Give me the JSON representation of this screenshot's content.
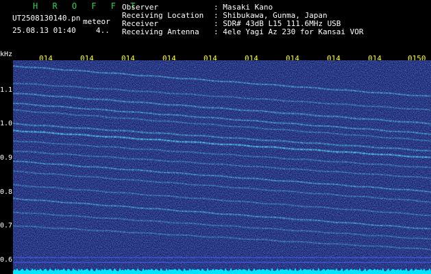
{
  "header": {
    "title": "H R O F F T",
    "filename": "UT2508130140.pn",
    "meteor_label": "meteor",
    "datetime": "25.08.13 01:40",
    "count": "4..",
    "observer_label": "Observer",
    "observer_value": ": Masaki Kano",
    "location_label": "Receiving Location",
    "location_value": ": Shibukawa, Gunma, Japan",
    "receiver_label": "Receiver",
    "receiver_value": ": SDR# 43dB L15 111.6MHz USB",
    "antenna_label": "Receiving Antenna",
    "antenna_value": ": 4ele Yagi Az 230 for Kansai VOR"
  },
  "axes": {
    "y_unit": "kHz",
    "y_ticks": [
      "1.1",
      "1.0",
      "0.9",
      "0.8",
      "0.7",
      "0.6"
    ],
    "x_ticks": [
      "014",
      "014",
      "014",
      "014",
      "014",
      "014",
      "014",
      "014",
      "014",
      "0150"
    ]
  },
  "colors": {
    "background": "#000000",
    "title_green": "#2bd34a",
    "text_white": "#ffffff",
    "tick_yellow": "#ffff00",
    "noise_blue": "#1d2c9e",
    "signal_cyan": "#5fe6ff",
    "baseline_cyan": "#00e5ff"
  },
  "chart_data": {
    "type": "heatmap",
    "title": "",
    "xlabel": "",
    "ylabel": "kHz",
    "ylim": [
      0.58,
      1.19
    ],
    "y_ticks": [
      1.1,
      1.0,
      0.9,
      0.8,
      0.7,
      0.6
    ],
    "x_tick_labels": [
      "014",
      "014",
      "014",
      "014",
      "014",
      "014",
      "014",
      "014",
      "014",
      "0150"
    ],
    "signal_traces_khz": [
      {
        "start": 1.17,
        "end": 1.08
      },
      {
        "start": 1.12,
        "end": 1.04
      },
      {
        "start": 1.09,
        "end": 1.0
      },
      {
        "start": 1.06,
        "end": 0.97
      },
      {
        "start": 1.04,
        "end": 0.95
      },
      {
        "start": 1.0,
        "end": 0.92
      },
      {
        "start": 0.98,
        "end": 0.9
      },
      {
        "start": 0.95,
        "end": 0.87
      },
      {
        "start": 0.92,
        "end": 0.84
      },
      {
        "start": 0.89,
        "end": 0.8
      },
      {
        "start": 0.86,
        "end": 0.77
      },
      {
        "start": 0.82,
        "end": 0.73
      },
      {
        "start": 0.78,
        "end": 0.69
      },
      {
        "start": 0.74,
        "end": 0.66
      },
      {
        "start": 0.7,
        "end": 0.63
      }
    ]
  }
}
